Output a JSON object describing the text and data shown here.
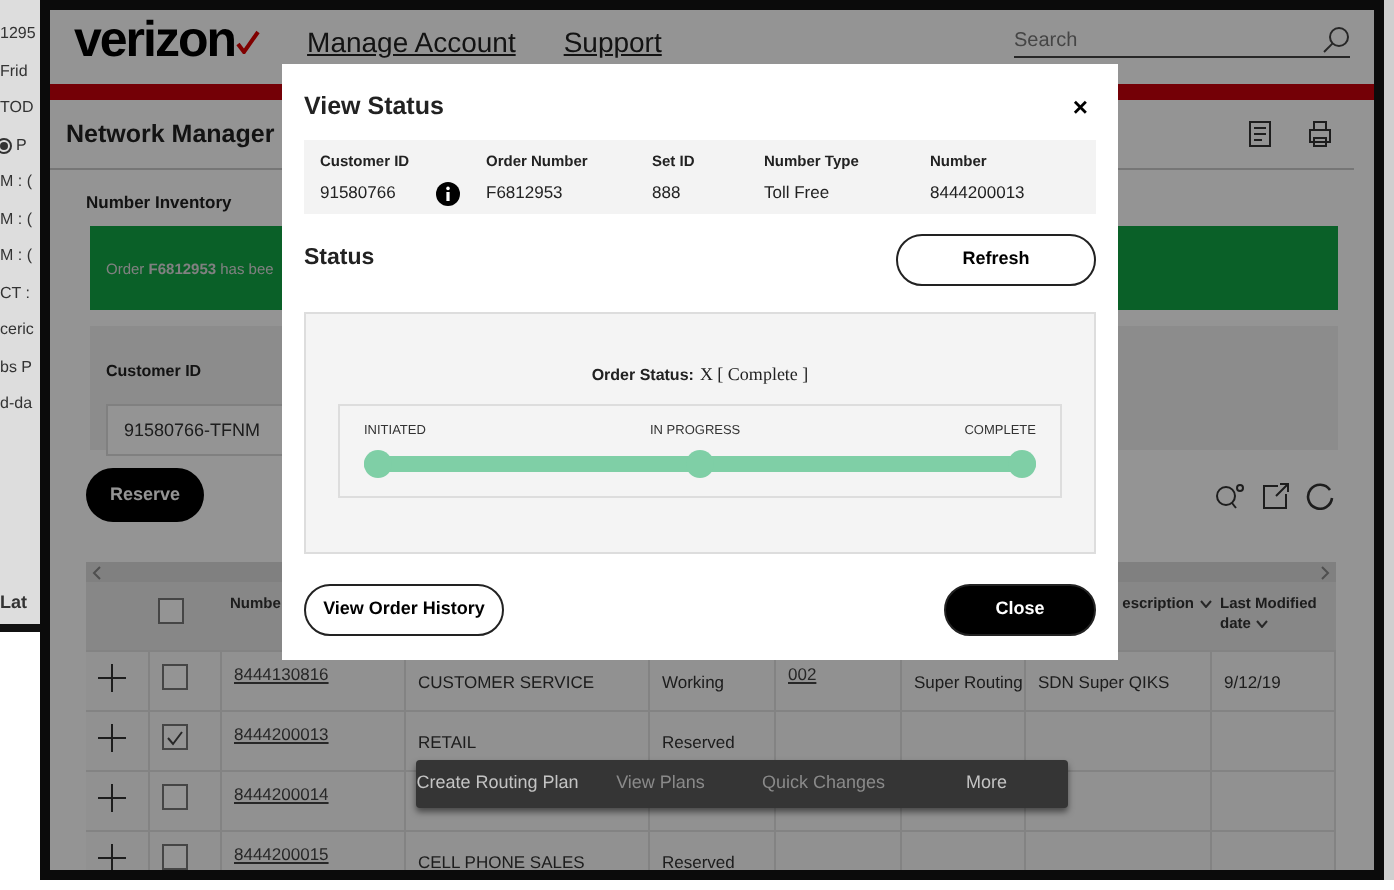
{
  "background_window": {
    "lines": [
      {
        "text": "1295",
        "kind": "text"
      },
      {
        "text": "Frid",
        "kind": "text"
      },
      {
        "text": "TOD",
        "kind": "text"
      },
      {
        "text": "P",
        "kind": "radio",
        "selected": true
      },
      {
        "text": "M : (",
        "kind": "text"
      },
      {
        "text": "M : (",
        "kind": "text"
      },
      {
        "text": "M : (",
        "kind": "text"
      },
      {
        "text": "CT :",
        "kind": "text"
      },
      {
        "text": "ceric",
        "kind": "text"
      },
      {
        "text": "bs P",
        "kind": "text"
      },
      {
        "text": "d-da",
        "kind": "text"
      }
    ],
    "footer": "Lat"
  },
  "header": {
    "logo": "verizon",
    "nav": [
      "Manage Account",
      "Support"
    ],
    "search": {
      "placeholder": "Search"
    }
  },
  "page": {
    "title": "Network Manager",
    "section": "Number Inventory",
    "alert": "Order **F6812953** has bee",
    "customer": {
      "label": "Customer ID",
      "value": "91580766-TFNM"
    },
    "reserve": "Reserve"
  },
  "table": {
    "columns": [
      {
        "kind": "expand"
      },
      {
        "kind": "select",
        "checked": false
      },
      {
        "kind": "text",
        "label": "Numbe"
      },
      {
        "kind": "text"
      },
      {
        "kind": "text"
      },
      {
        "kind": "text"
      },
      {
        "kind": "text"
      },
      {
        "kind": "text",
        "label": "escription",
        "sortable": true
      },
      {
        "kind": "text",
        "label": "Last Modified date",
        "sortable": true
      }
    ],
    "rows": [
      {
        "checked": false,
        "number": "8444130816",
        "cells": [
          {
            "text": "CUSTOMER SERVICE"
          },
          {
            "text": "Working"
          },
          {
            "text": "002",
            "link": true
          },
          {
            "text": "Super Routing"
          },
          {
            "text": "SDN Super QIKS"
          },
          {
            "text": "9/12/19"
          }
        ]
      },
      {
        "checked": true,
        "number": "8444200013",
        "cells": [
          {
            "text": "RETAIL"
          },
          {
            "text": "Reserved"
          }
        ]
      },
      {
        "checked": false,
        "number": "8444200014",
        "cells": []
      },
      {
        "checked": false,
        "number": "8444200015",
        "cells": [
          {
            "text": "CELL PHONE SALES"
          },
          {
            "text": "Reserved"
          }
        ]
      }
    ]
  },
  "context_menu": [
    {
      "label": "Create Routing Plan",
      "disabled": false
    },
    {
      "label": "View Plans",
      "disabled": true
    },
    {
      "label": "Quick Changes",
      "disabled": true
    },
    {
      "label": "More",
      "disabled": false
    }
  ],
  "modal": {
    "title": "View Status",
    "close": "×",
    "info": [
      {
        "label": "Customer ID",
        "value": "91580766",
        "info": true
      },
      {
        "label": "Order Number",
        "value": "F6812953"
      },
      {
        "label": "Set ID",
        "value": "888"
      },
      {
        "label": "Number Type",
        "value": "Toll Free"
      },
      {
        "label": "Number",
        "value": "8444200013"
      }
    ],
    "status_heading": "Status",
    "refresh": "Refresh",
    "order_status_label": "Order Status:",
    "order_status_value": "X [ Complete ]",
    "progress": {
      "level": 1,
      "steps": [
        {
          "label": "INITIATED",
          "reached": true
        },
        {
          "label": "IN PROGRESS",
          "reached": true
        },
        {
          "label": "COMPLETE",
          "reached": true
        }
      ]
    },
    "history": "View Order History",
    "close_button": "Close"
  }
}
